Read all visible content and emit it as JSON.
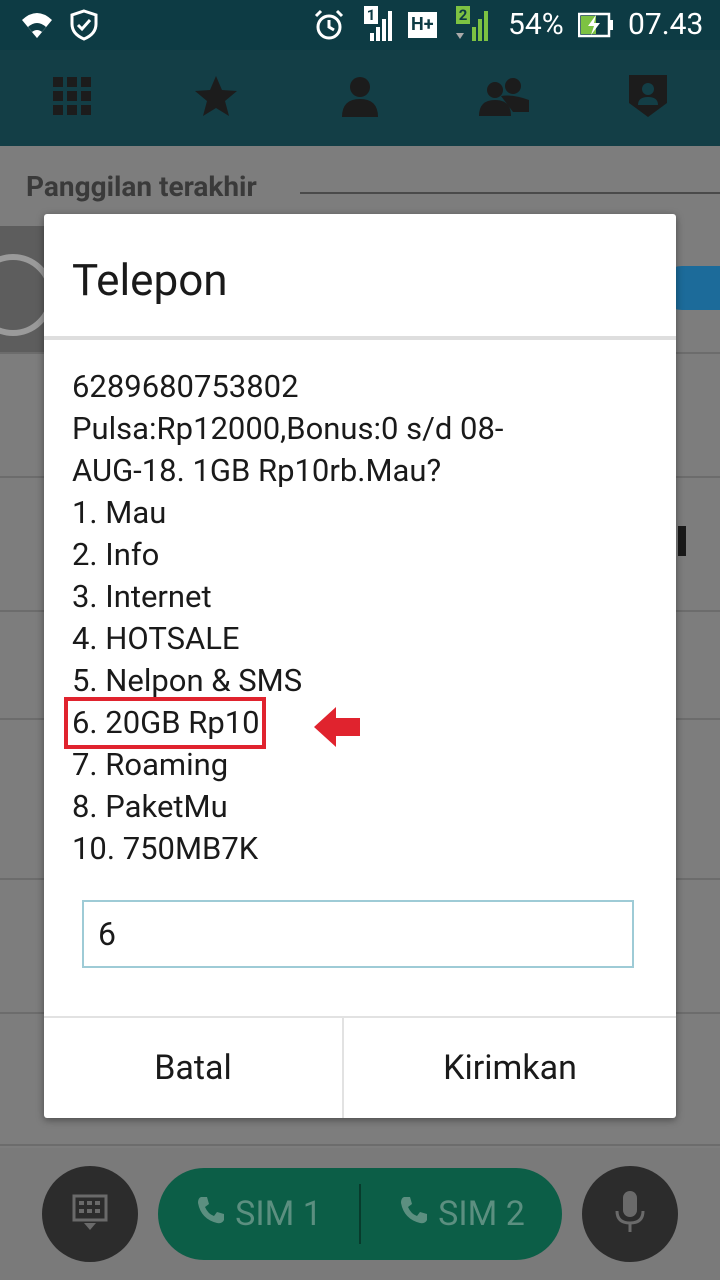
{
  "status_bar": {
    "sim_badge_1": "1",
    "network_type": "H+",
    "sim_badge_2": "2",
    "battery_percent": "54%",
    "time": "07.43",
    "icons": [
      "wifi-icon",
      "shield-check-icon",
      "alarm-icon",
      "signal-sim1-icon",
      "network-hplus-icon",
      "signal-sim2-icon",
      "battery-charging-icon"
    ]
  },
  "tabs": [
    {
      "name": "dialpad-tab",
      "icon": "grid-icon"
    },
    {
      "name": "favorites-tab",
      "icon": "star-icon"
    },
    {
      "name": "contacts-tab",
      "icon": "person-icon"
    },
    {
      "name": "groups-tab",
      "icon": "group-icon"
    },
    {
      "name": "profile-tab",
      "icon": "badge-icon"
    }
  ],
  "background": {
    "section_label": "Panggilan terakhir"
  },
  "bottom_bar": {
    "sim1_label": "SIM 1",
    "sim2_label": "SIM 2",
    "left_icon": "dialpad-hide-icon",
    "right_icon": "microphone-icon"
  },
  "dialog": {
    "title": "Telepon",
    "message_lines": [
      "6289680753802",
      "Pulsa:Rp12000,Bonus:0 s/d 08-",
      "AUG-18. 1GB Rp10rb.Mau?",
      "1. Mau",
      "2. Info",
      "3. Internet",
      "4. HOTSALE",
      "5. Nelpon & SMS",
      "6. 20GB Rp10",
      "7. Roaming",
      "8. PaketMu",
      "10. 750MB7K"
    ],
    "input_value": "6",
    "cancel_label": "Batal",
    "send_label": "Kirimkan"
  },
  "colors": {
    "status_bar": "#0d3b44",
    "highlight": "#e0232e",
    "sim_pill": "#0c5e47"
  }
}
